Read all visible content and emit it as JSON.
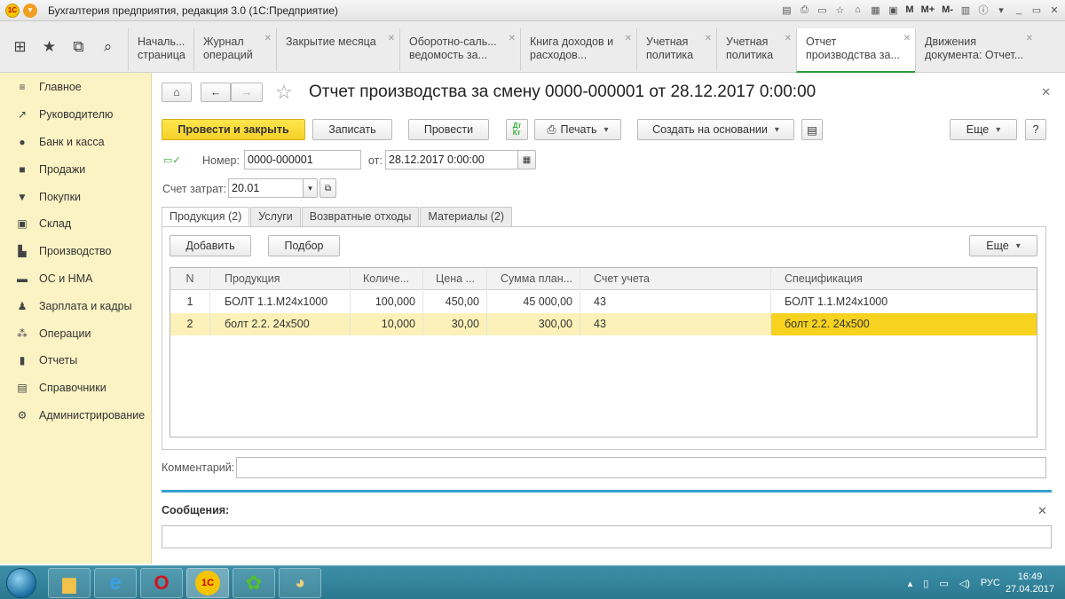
{
  "window": {
    "title": "Бухгалтерия предприятия, редакция 3.0  (1С:Предприятие)",
    "toolbar_m": [
      "M",
      "M+",
      "M-"
    ]
  },
  "tabs": [
    {
      "label": "Началь... страница",
      "closable": false,
      "active": false
    },
    {
      "label": "Журнал операций",
      "closable": true,
      "active": false
    },
    {
      "label": "Закрытие месяца",
      "closable": true,
      "active": false
    },
    {
      "label": "Оборотно-саль... ведомость за...",
      "closable": true,
      "active": false
    },
    {
      "label": "Книга доходов и расходов...",
      "closable": true,
      "active": false
    },
    {
      "label": "Учетная политика",
      "closable": true,
      "active": false
    },
    {
      "label": "Учетная политика",
      "closable": true,
      "active": false
    },
    {
      "label": "Отчет производства за...",
      "closable": true,
      "active": true
    },
    {
      "label": "Движения документа: Отчет...",
      "closable": true,
      "active": false
    }
  ],
  "sidebar": {
    "items": [
      {
        "label": "Главное",
        "icon": "menu-icon"
      },
      {
        "label": "Руководителю",
        "icon": "chart-icon"
      },
      {
        "label": "Банк и касса",
        "icon": "coin-icon"
      },
      {
        "label": "Продажи",
        "icon": "bag-icon"
      },
      {
        "label": "Покупки",
        "icon": "cart-icon"
      },
      {
        "label": "Склад",
        "icon": "warehouse-icon"
      },
      {
        "label": "Производство",
        "icon": "factory-icon"
      },
      {
        "label": "ОС и НМА",
        "icon": "car-icon"
      },
      {
        "label": "Зарплата и кадры",
        "icon": "people-icon"
      },
      {
        "label": "Операции",
        "icon": "operations-icon"
      },
      {
        "label": "Отчеты",
        "icon": "bars-icon"
      },
      {
        "label": "Справочники",
        "icon": "book-icon"
      },
      {
        "label": "Администрирование",
        "icon": "gear-icon"
      }
    ]
  },
  "document": {
    "title": "Отчет производства за смену 0000-000001 от 28.12.2017 0:00:00",
    "buttons": {
      "post_close": "Провести и закрыть",
      "save": "Записать",
      "post": "Провести",
      "print": "Печать",
      "create_based": "Создать на основании",
      "more": "Еще",
      "help": "?"
    },
    "number_label": "Номер:",
    "number_value": "0000-000001",
    "date_label": "от:",
    "date_value": "28.12.2017  0:00:00",
    "account_label": "Счет затрат:",
    "account_value": "20.01",
    "form_tabs": [
      "Продукция (2)",
      "Услуги",
      "Возвратные отходы",
      "Материалы (2)"
    ],
    "table_buttons": {
      "add": "Добавить",
      "select": "Подбор",
      "more": "Еще"
    },
    "table": {
      "columns": [
        "N",
        "Продукция",
        "Количе...",
        "Цена ...",
        "Сумма план...",
        "Счет учета",
        "Спецификация"
      ],
      "rows": [
        [
          "1",
          "БОЛТ 1.1.М24х1000",
          "100,000",
          "450,00",
          "45 000,00",
          "43",
          "БОЛТ 1.1.М24х1000"
        ],
        [
          "2",
          "болт 2.2. 24х500",
          "10,000",
          "30,00",
          "300,00",
          "43",
          "болт 2.2. 24х500"
        ]
      ]
    },
    "comment_label": "Комментарий:",
    "messages_label": "Сообщения:"
  },
  "taskbar": {
    "lang": "РУС",
    "time": "16:49",
    "date": "27.04.2017"
  }
}
